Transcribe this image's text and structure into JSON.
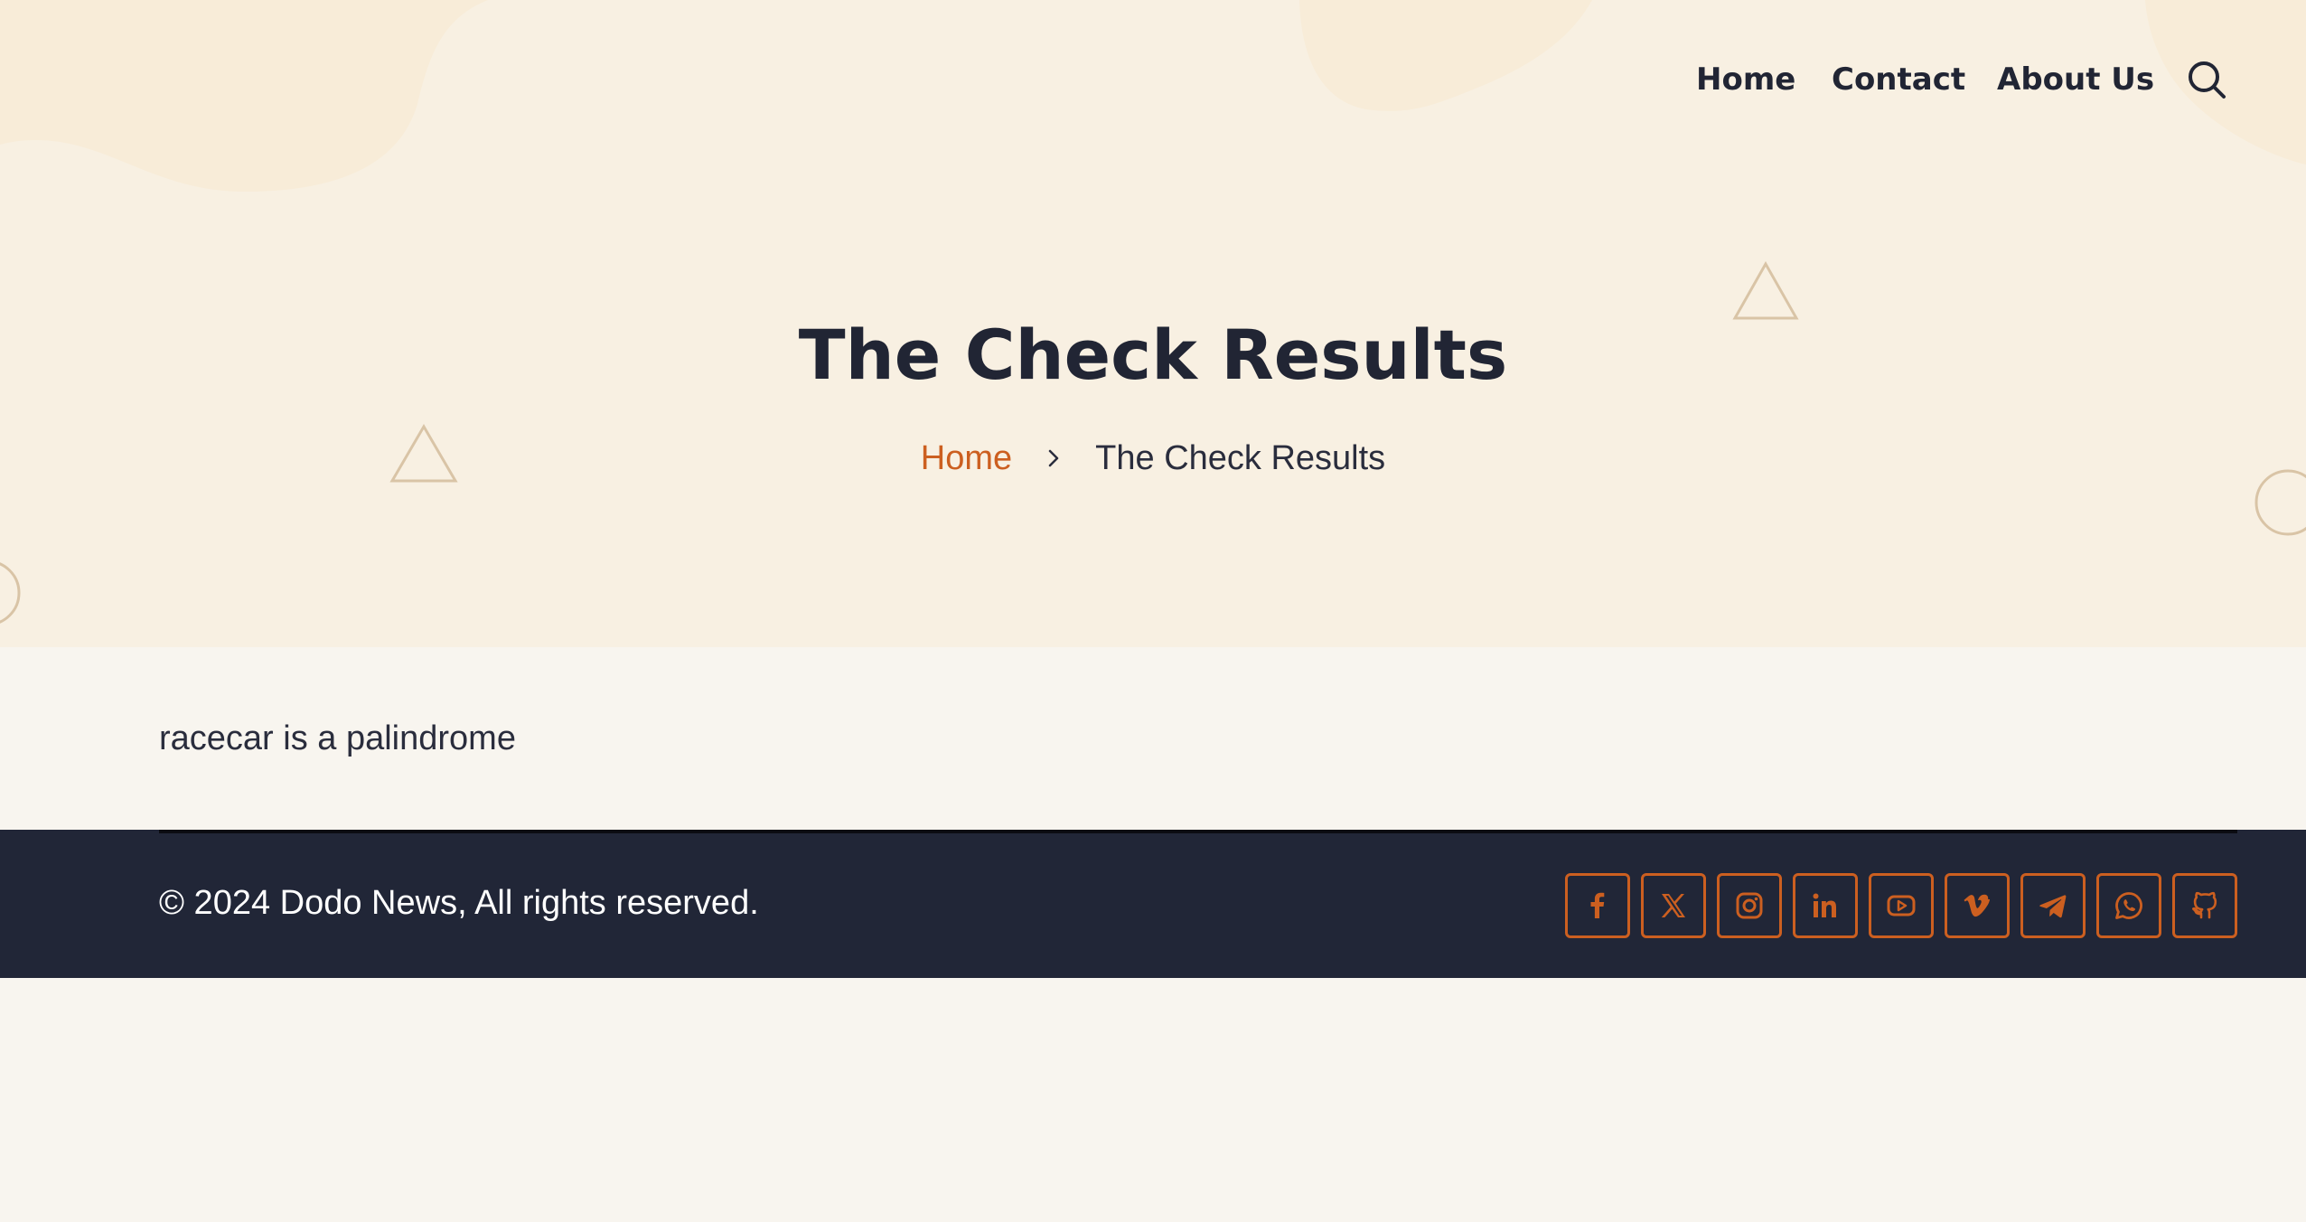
{
  "colors": {
    "hero_bg": "#f8f0e2",
    "page_bg": "#f8f5ef",
    "accent": "#cc5f20",
    "text_dark": "#212534",
    "footer_bg": "#212637",
    "decoration": "#d9c4a6"
  },
  "nav": {
    "items": [
      {
        "label": "Home"
      },
      {
        "label": "Contact"
      },
      {
        "label": "About Us"
      }
    ],
    "search_icon": "search-icon"
  },
  "hero": {
    "title": "The Check Results",
    "breadcrumb": {
      "home": "Home",
      "separator_icon": "chevron-right-icon",
      "current": "The Check Results"
    }
  },
  "main": {
    "result_text": "racecar is a palindrome"
  },
  "footer": {
    "copyright": "© 2024 Dodo News, All rights reserved.",
    "socials": [
      {
        "icon": "facebook-icon"
      },
      {
        "icon": "x-twitter-icon"
      },
      {
        "icon": "instagram-icon"
      },
      {
        "icon": "linkedin-icon"
      },
      {
        "icon": "youtube-icon"
      },
      {
        "icon": "vimeo-icon"
      },
      {
        "icon": "telegram-icon"
      },
      {
        "icon": "whatsapp-icon"
      },
      {
        "icon": "github-icon"
      }
    ]
  }
}
